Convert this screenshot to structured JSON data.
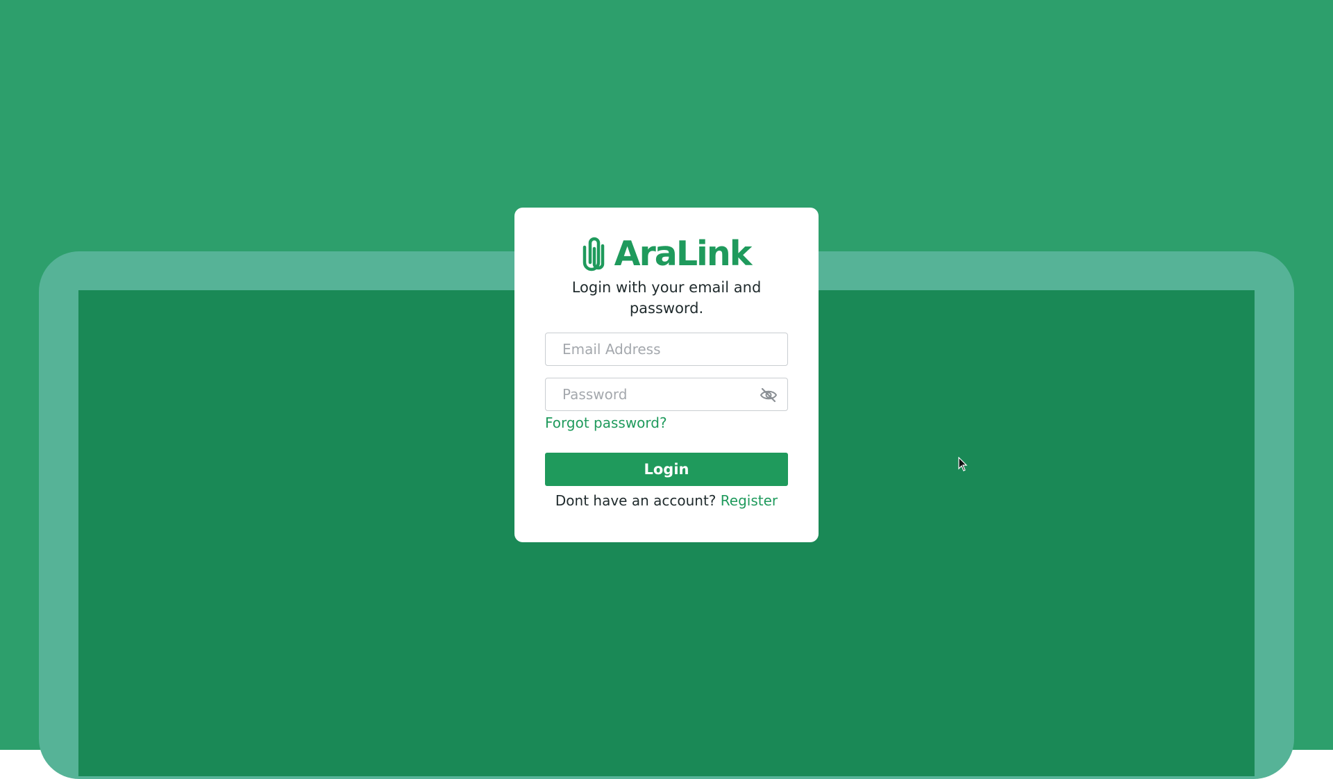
{
  "brand": {
    "name": "AraLink",
    "logo_icon": "paperclip-icon",
    "color": "#1f9a5c"
  },
  "login": {
    "subtitle": "Login with your email and password.",
    "email_placeholder": "Email Address",
    "password_placeholder": "Password",
    "password_toggle_icon": "eye-off-icon",
    "forgot_password": "Forgot password?",
    "login_button": "Login",
    "register_prompt": "Dont have an account?",
    "register_link": "Register"
  },
  "colors": {
    "background": "#2d9f6c",
    "frame_border": "#56b397",
    "frame_fill": "#1a8956",
    "accent": "#1f9a5c"
  }
}
